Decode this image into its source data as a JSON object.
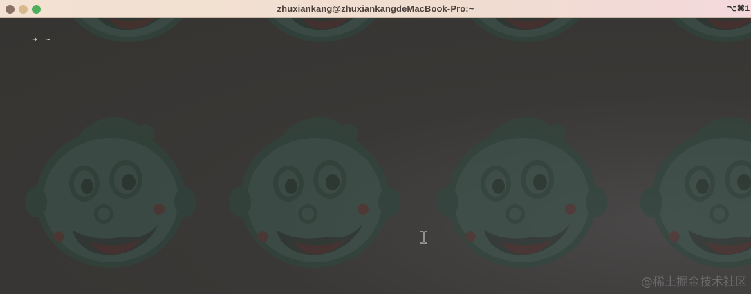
{
  "window": {
    "title": "zhuxiankang@zhuxiankangdeMacBook-Pro:~",
    "shortcut": "⌥⌘1"
  },
  "terminal": {
    "prompt_arrow": "➜",
    "prompt_dir": "~",
    "input": ""
  },
  "watermark": "@稀土掘金技术社区",
  "colors": {
    "titlebar": "#f3e2d2",
    "terminal_bg": "#3a3835",
    "text": "#c9c6bd",
    "close": "#8a7168",
    "minimize": "#d8b98c",
    "zoom": "#4fae5c"
  },
  "icons": {
    "close": "close-button",
    "minimize": "minimize-button",
    "zoom": "zoom-button",
    "text_cursor": "ibeam-cursor-icon",
    "wallpaper": "cartoon-face-wallpaper"
  }
}
